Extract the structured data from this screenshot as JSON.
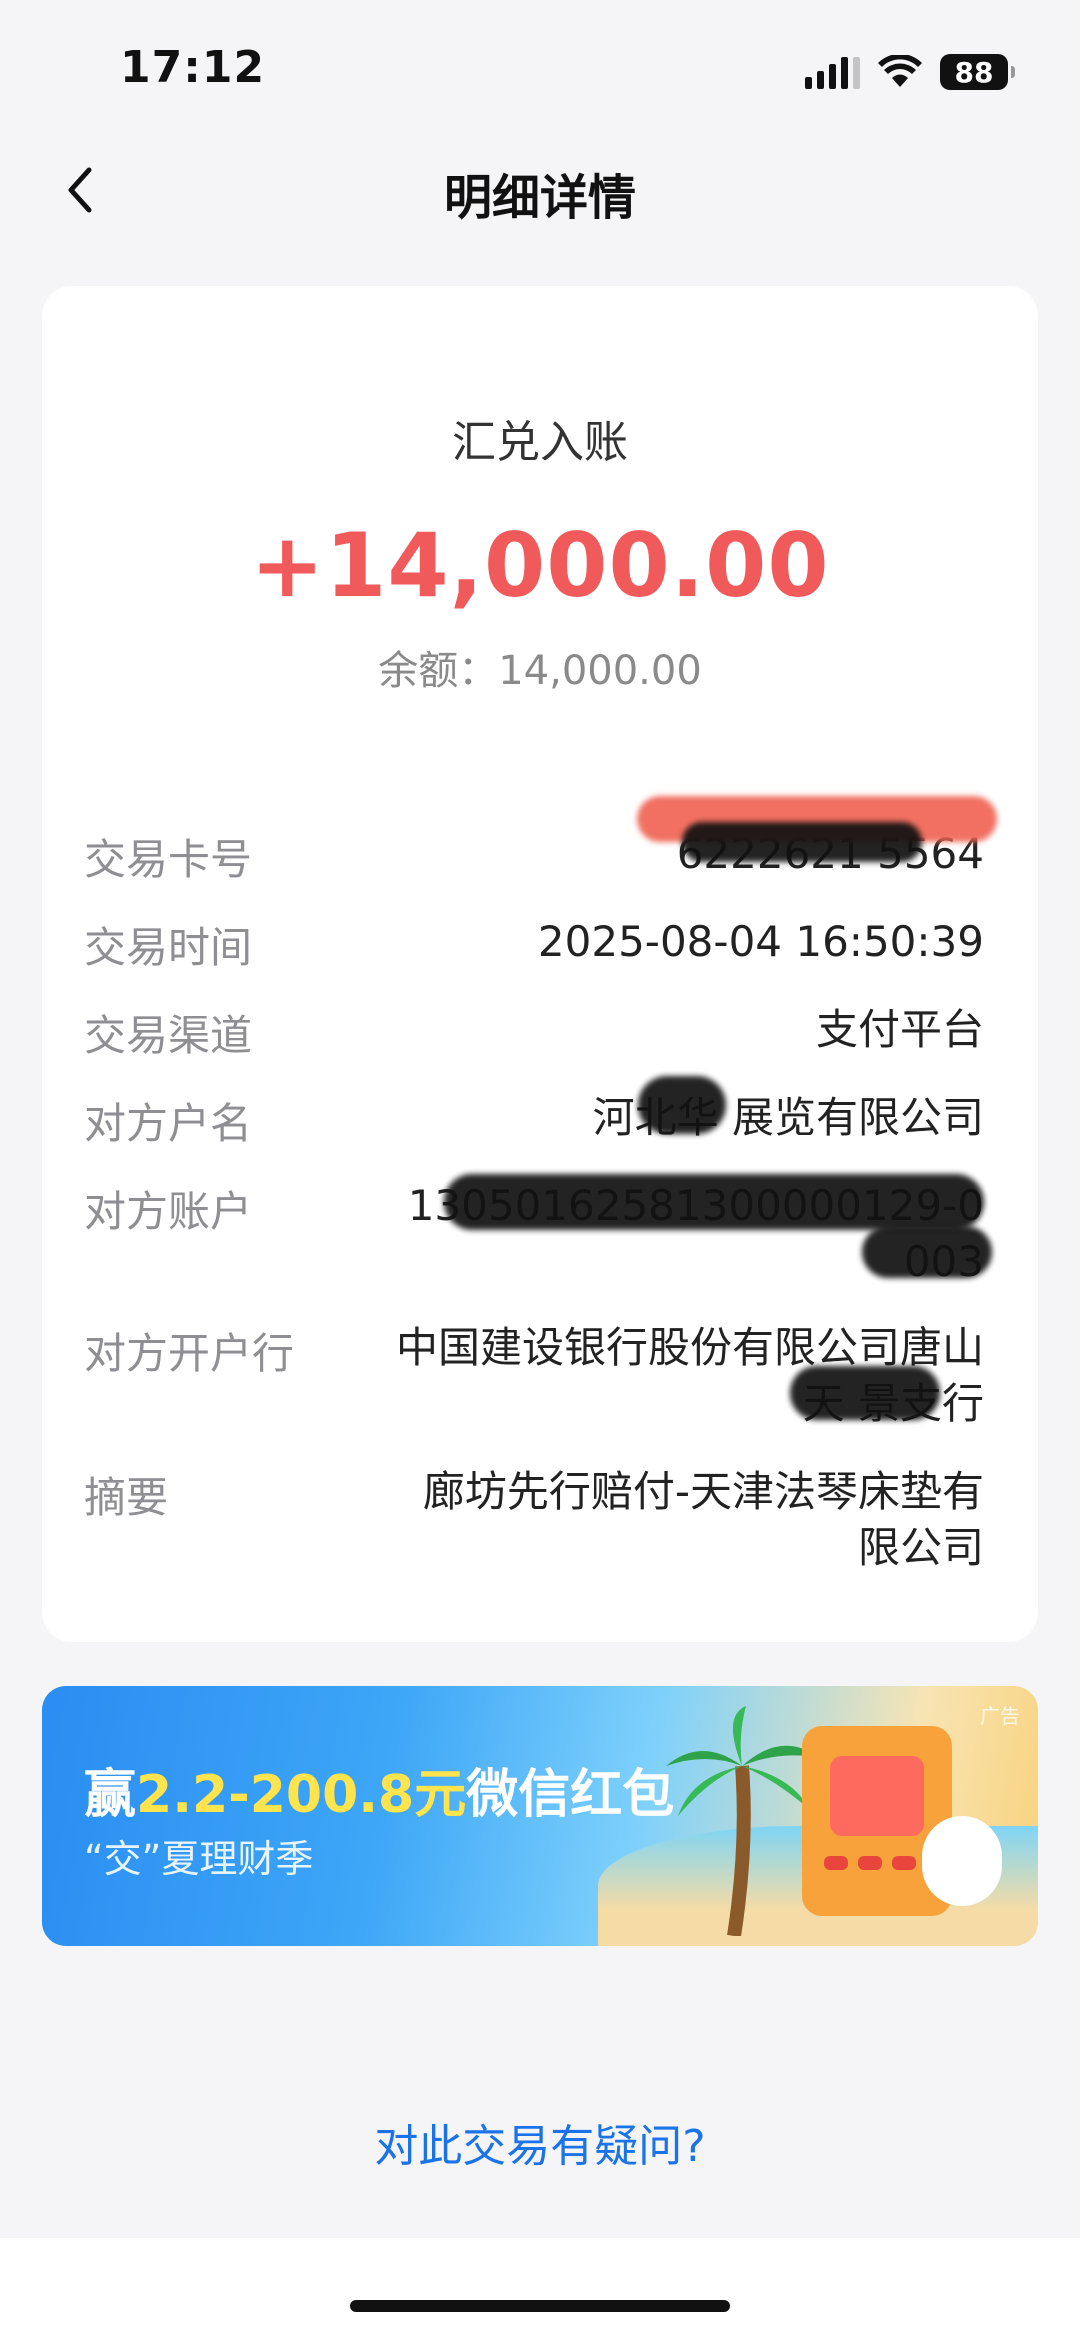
{
  "status_bar": {
    "time": "17:12",
    "battery": "88"
  },
  "nav": {
    "title": "明细详情"
  },
  "summary": {
    "type": "汇兑入账",
    "amount": "+14,000.00",
    "balance": "余额：14,000.00"
  },
  "details": [
    {
      "label": "交易卡号",
      "value": "6222621   5564"
    },
    {
      "label": "交易时间",
      "value": "2025-08-04 16:50:39"
    },
    {
      "label": "交易渠道",
      "value": "支付平台"
    },
    {
      "label": "对方户名",
      "value": "河北华   展览有限公司"
    },
    {
      "label": "对方账户",
      "value": "13050162581300000129-0003"
    },
    {
      "label": "对方开户行",
      "value": "中国建设银行股份有限公司唐山天   景支行"
    },
    {
      "label": "摘要",
      "value": "廊坊先行赔付-天津法琴床垫有限公司"
    }
  ],
  "banner": {
    "title_prefix": "赢",
    "title_highlight": "2.2-200.8元",
    "title_suffix": "微信红包",
    "subtitle": "“交”夏理财季",
    "tag": "广告"
  },
  "footer": {
    "question": "对此交易有疑问?"
  },
  "colors": {
    "amount": "#f15a5a",
    "link": "#1a73e8",
    "background": "#f5f5f7"
  }
}
